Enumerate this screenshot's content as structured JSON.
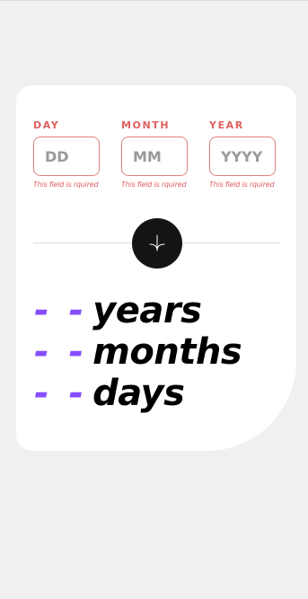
{
  "form": {
    "day": {
      "label": "DAY",
      "placeholder": "DD",
      "value": "",
      "error": "This field is rquired"
    },
    "month": {
      "label": "MONTH",
      "placeholder": "MM",
      "value": "",
      "error": "This field is rquired"
    },
    "year": {
      "label": "YEAR",
      "placeholder": "YYYY",
      "value": "",
      "error": "This field is rquired"
    }
  },
  "submit": {
    "icon": "arrow-down-icon"
  },
  "results": {
    "years": {
      "value": "- -",
      "unit": "years"
    },
    "months": {
      "value": "- -",
      "unit": "months"
    },
    "days": {
      "value": "- -",
      "unit": "days"
    }
  },
  "colors": {
    "accent": "#854dff",
    "error": "#e05f5f",
    "button": "#141414",
    "card": "#ffffff",
    "background": "#f0f0f0"
  }
}
